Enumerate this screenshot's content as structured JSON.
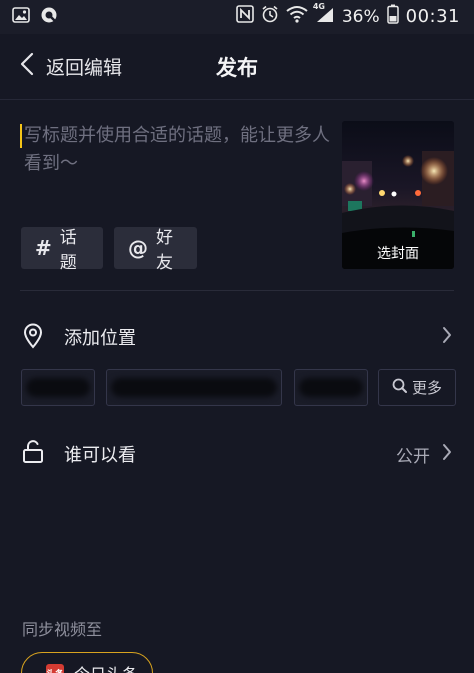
{
  "status_bar": {
    "battery_percent": "36%",
    "time": "00:31",
    "network_label": "4G",
    "icons": [
      "gallery-icon",
      "q-app-icon",
      "nfc-icon",
      "alarm-icon",
      "wifi-icon",
      "signal-icon",
      "battery-icon"
    ]
  },
  "nav": {
    "back_label": "返回编辑",
    "title": "发布"
  },
  "title_input": {
    "placeholder": "写标题并使用合适的话题，能让更多人看到～"
  },
  "cover": {
    "label": "选封面"
  },
  "chips": {
    "topic": {
      "icon": "#",
      "label": "话题"
    },
    "friend": {
      "icon": "@",
      "label": "好友"
    }
  },
  "location": {
    "label": "添加位置",
    "more_label": "更多"
  },
  "visibility": {
    "label": "谁可以看",
    "value": "公开"
  },
  "sync": {
    "label": "同步视频至",
    "target_label": "今日头条",
    "target_logo_text": "头条"
  },
  "colors": {
    "background": "#161824",
    "chip_bg": "#2b2d3a",
    "caret": "#f5c518",
    "sync_border": "#d8a31f",
    "toutiao_red": "#d43c33"
  }
}
